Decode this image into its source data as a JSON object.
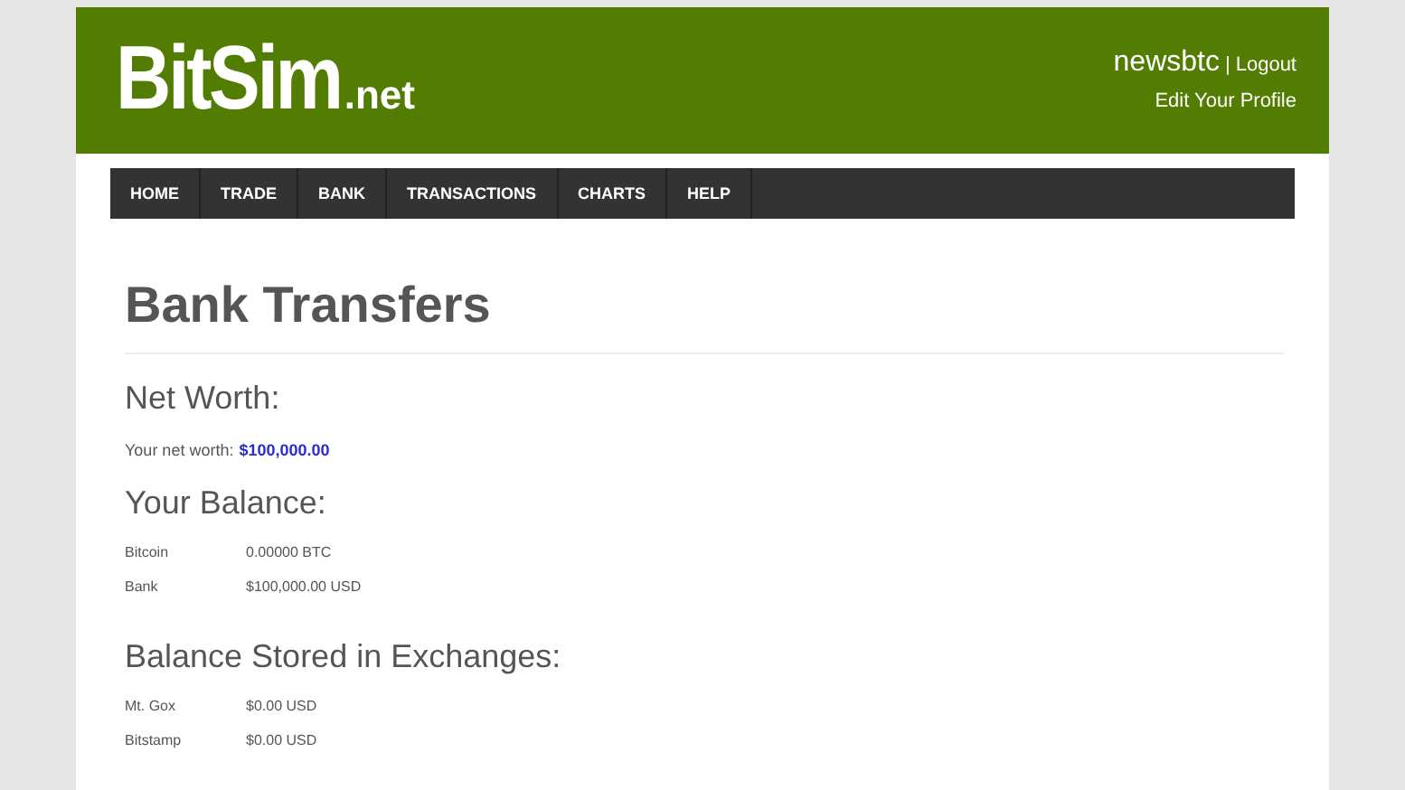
{
  "header": {
    "logo": "BitSim",
    "logo_suffix": ".net",
    "username": "newsbtc",
    "separator": "|",
    "logout": "Logout",
    "edit_profile": "Edit Your Profile"
  },
  "nav": [
    {
      "label": "HOME"
    },
    {
      "label": "TRADE"
    },
    {
      "label": "BANK"
    },
    {
      "label": "TRANSACTIONS"
    },
    {
      "label": "CHARTS"
    },
    {
      "label": "HELP"
    }
  ],
  "title": "Bank Transfers",
  "net_worth": {
    "heading": "Net Worth:",
    "label": "Your net worth:",
    "value": "$100,000.00"
  },
  "sections": [
    {
      "heading": "Your Balance:",
      "rows": [
        {
          "name": "Bitcoin",
          "amount": "0.00000 BTC"
        },
        {
          "name": "Bank",
          "amount": "$100,000.00 USD"
        }
      ]
    },
    {
      "heading": "Balance Stored in Exchanges:",
      "rows": [
        {
          "name": "Mt. Gox",
          "amount": "$0.00 USD"
        },
        {
          "name": "Bitstamp",
          "amount": "$0.00 USD"
        }
      ]
    }
  ]
}
